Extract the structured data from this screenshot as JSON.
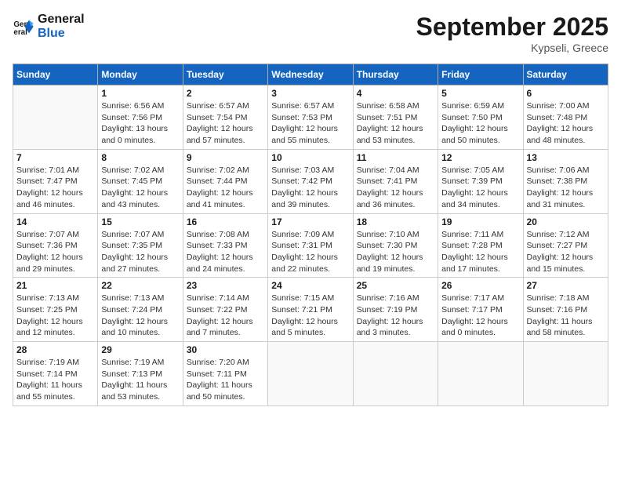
{
  "header": {
    "logo_general": "General",
    "logo_blue": "Blue",
    "month": "September 2025",
    "location": "Kypseli, Greece"
  },
  "weekdays": [
    "Sunday",
    "Monday",
    "Tuesday",
    "Wednesday",
    "Thursday",
    "Friday",
    "Saturday"
  ],
  "weeks": [
    [
      {
        "day": "",
        "info": ""
      },
      {
        "day": "1",
        "info": "Sunrise: 6:56 AM\nSunset: 7:56 PM\nDaylight: 13 hours\nand 0 minutes."
      },
      {
        "day": "2",
        "info": "Sunrise: 6:57 AM\nSunset: 7:54 PM\nDaylight: 12 hours\nand 57 minutes."
      },
      {
        "day": "3",
        "info": "Sunrise: 6:57 AM\nSunset: 7:53 PM\nDaylight: 12 hours\nand 55 minutes."
      },
      {
        "day": "4",
        "info": "Sunrise: 6:58 AM\nSunset: 7:51 PM\nDaylight: 12 hours\nand 53 minutes."
      },
      {
        "day": "5",
        "info": "Sunrise: 6:59 AM\nSunset: 7:50 PM\nDaylight: 12 hours\nand 50 minutes."
      },
      {
        "day": "6",
        "info": "Sunrise: 7:00 AM\nSunset: 7:48 PM\nDaylight: 12 hours\nand 48 minutes."
      }
    ],
    [
      {
        "day": "7",
        "info": "Sunrise: 7:01 AM\nSunset: 7:47 PM\nDaylight: 12 hours\nand 46 minutes."
      },
      {
        "day": "8",
        "info": "Sunrise: 7:02 AM\nSunset: 7:45 PM\nDaylight: 12 hours\nand 43 minutes."
      },
      {
        "day": "9",
        "info": "Sunrise: 7:02 AM\nSunset: 7:44 PM\nDaylight: 12 hours\nand 41 minutes."
      },
      {
        "day": "10",
        "info": "Sunrise: 7:03 AM\nSunset: 7:42 PM\nDaylight: 12 hours\nand 39 minutes."
      },
      {
        "day": "11",
        "info": "Sunrise: 7:04 AM\nSunset: 7:41 PM\nDaylight: 12 hours\nand 36 minutes."
      },
      {
        "day": "12",
        "info": "Sunrise: 7:05 AM\nSunset: 7:39 PM\nDaylight: 12 hours\nand 34 minutes."
      },
      {
        "day": "13",
        "info": "Sunrise: 7:06 AM\nSunset: 7:38 PM\nDaylight: 12 hours\nand 31 minutes."
      }
    ],
    [
      {
        "day": "14",
        "info": "Sunrise: 7:07 AM\nSunset: 7:36 PM\nDaylight: 12 hours\nand 29 minutes."
      },
      {
        "day": "15",
        "info": "Sunrise: 7:07 AM\nSunset: 7:35 PM\nDaylight: 12 hours\nand 27 minutes."
      },
      {
        "day": "16",
        "info": "Sunrise: 7:08 AM\nSunset: 7:33 PM\nDaylight: 12 hours\nand 24 minutes."
      },
      {
        "day": "17",
        "info": "Sunrise: 7:09 AM\nSunset: 7:31 PM\nDaylight: 12 hours\nand 22 minutes."
      },
      {
        "day": "18",
        "info": "Sunrise: 7:10 AM\nSunset: 7:30 PM\nDaylight: 12 hours\nand 19 minutes."
      },
      {
        "day": "19",
        "info": "Sunrise: 7:11 AM\nSunset: 7:28 PM\nDaylight: 12 hours\nand 17 minutes."
      },
      {
        "day": "20",
        "info": "Sunrise: 7:12 AM\nSunset: 7:27 PM\nDaylight: 12 hours\nand 15 minutes."
      }
    ],
    [
      {
        "day": "21",
        "info": "Sunrise: 7:13 AM\nSunset: 7:25 PM\nDaylight: 12 hours\nand 12 minutes."
      },
      {
        "day": "22",
        "info": "Sunrise: 7:13 AM\nSunset: 7:24 PM\nDaylight: 12 hours\nand 10 minutes."
      },
      {
        "day": "23",
        "info": "Sunrise: 7:14 AM\nSunset: 7:22 PM\nDaylight: 12 hours\nand 7 minutes."
      },
      {
        "day": "24",
        "info": "Sunrise: 7:15 AM\nSunset: 7:21 PM\nDaylight: 12 hours\nand 5 minutes."
      },
      {
        "day": "25",
        "info": "Sunrise: 7:16 AM\nSunset: 7:19 PM\nDaylight: 12 hours\nand 3 minutes."
      },
      {
        "day": "26",
        "info": "Sunrise: 7:17 AM\nSunset: 7:17 PM\nDaylight: 12 hours\nand 0 minutes."
      },
      {
        "day": "27",
        "info": "Sunrise: 7:18 AM\nSunset: 7:16 PM\nDaylight: 11 hours\nand 58 minutes."
      }
    ],
    [
      {
        "day": "28",
        "info": "Sunrise: 7:19 AM\nSunset: 7:14 PM\nDaylight: 11 hours\nand 55 minutes."
      },
      {
        "day": "29",
        "info": "Sunrise: 7:19 AM\nSunset: 7:13 PM\nDaylight: 11 hours\nand 53 minutes."
      },
      {
        "day": "30",
        "info": "Sunrise: 7:20 AM\nSunset: 7:11 PM\nDaylight: 11 hours\nand 50 minutes."
      },
      {
        "day": "",
        "info": ""
      },
      {
        "day": "",
        "info": ""
      },
      {
        "day": "",
        "info": ""
      },
      {
        "day": "",
        "info": ""
      }
    ]
  ]
}
